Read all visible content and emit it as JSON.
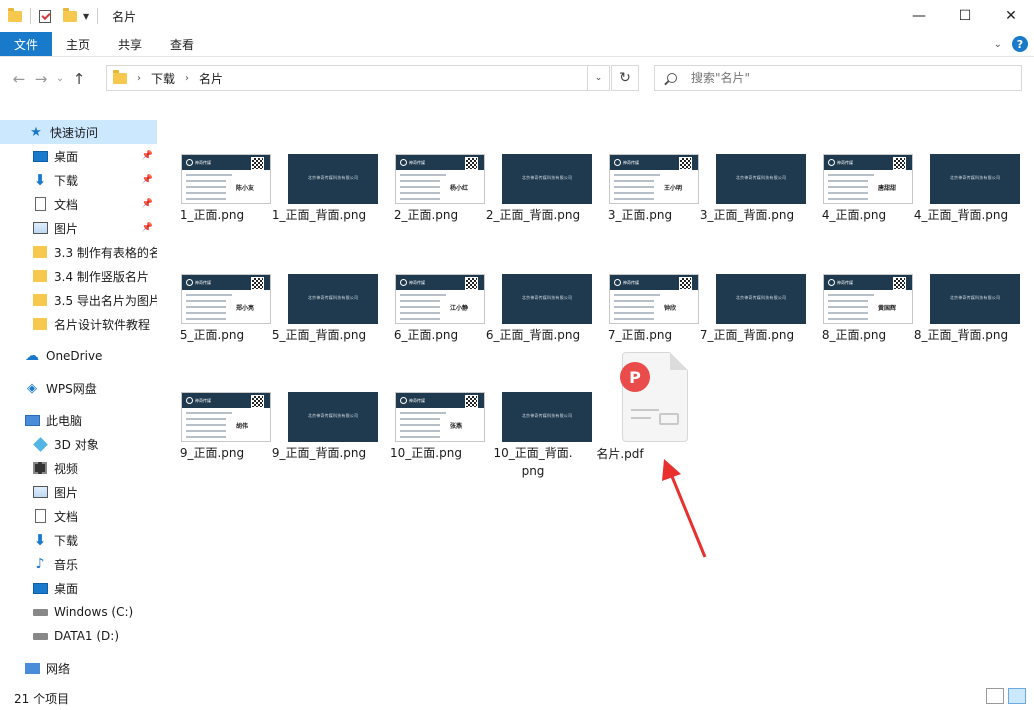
{
  "window": {
    "title": "名片",
    "minimize": "—",
    "maximize": "☐",
    "close": "✕"
  },
  "ribbon": {
    "tabs": [
      "文件",
      "主页",
      "共享",
      "查看"
    ],
    "help": "?"
  },
  "nav": {
    "back": "←",
    "forward": "→",
    "recent": "⌄",
    "up": "↑",
    "breadcrumb": [
      "下载",
      "名片"
    ],
    "refresh": "↻"
  },
  "search": {
    "placeholder": "搜索\"名片\""
  },
  "sidebar": {
    "quick_access": "快速访问",
    "pinned": [
      {
        "label": "桌面",
        "icon": "desktop-icon"
      },
      {
        "label": "下载",
        "icon": "download-arrow-icon"
      },
      {
        "label": "文档",
        "icon": "document-icon"
      },
      {
        "label": "图片",
        "icon": "pictures-icon"
      }
    ],
    "recent_folders": [
      "3.3 制作有表格的名",
      "3.4 制作竖版名片",
      "3.5 导出名片为图片",
      "名片设计软件教程"
    ],
    "onedrive": "OneDrive",
    "wps": "WPS网盘",
    "this_pc": "此电脑",
    "pc_items": [
      {
        "label": "3D 对象",
        "icon": "3d-objects-icon"
      },
      {
        "label": "视频",
        "icon": "video-icon"
      },
      {
        "label": "图片",
        "icon": "pictures-icon"
      },
      {
        "label": "文档",
        "icon": "document-icon"
      },
      {
        "label": "下载",
        "icon": "download-arrow-icon"
      },
      {
        "label": "音乐",
        "icon": "music-icon"
      },
      {
        "label": "桌面",
        "icon": "desktop-icon"
      },
      {
        "label": "Windows (C:)",
        "icon": "windows-drive-icon"
      },
      {
        "label": "DATA1 (D:)",
        "icon": "drive-icon"
      }
    ],
    "network": "网络"
  },
  "files": {
    "rows": [
      [
        {
          "label": "1_正面.png",
          "name": "陈小友"
        },
        {
          "label": "1_正面_背面.png"
        },
        {
          "label": "2_正面.png",
          "name": "杨小红"
        },
        {
          "label": "2_正面_背面.png"
        },
        {
          "label": "3_正面.png",
          "name": "王小明"
        },
        {
          "label": "3_正面_背面.png"
        },
        {
          "label": "4_正面.png",
          "name": "唐甜甜"
        },
        {
          "label": "4_正面_背面.png"
        }
      ],
      [
        {
          "label": "5_正面.png",
          "name": "郑小亮"
        },
        {
          "label": "5_正面_背面.png"
        },
        {
          "label": "6_正面.png",
          "name": "江小静"
        },
        {
          "label": "6_正面_背面.png"
        },
        {
          "label": "7_正面.png",
          "name": "钟欣"
        },
        {
          "label": "7_正面_背面.png"
        },
        {
          "label": "8_正面.png",
          "name": "黄国辉"
        },
        {
          "label": "8_正面_背面.png"
        }
      ],
      [
        {
          "label": "9_正面.png",
          "name": "胡伟"
        },
        {
          "label": "9_正面_背面.png"
        },
        {
          "label": "10_正面.png",
          "name": "张燕"
        },
        {
          "label": "10_正面_背面.\npng"
        }
      ]
    ],
    "card_back_text": "北京神奇传媒科技有限公司",
    "card_front_brand": "神奇传媒",
    "pdf": {
      "label": "名片.pdf",
      "badge": "P"
    }
  },
  "status": {
    "count": "21 个项目"
  },
  "colors": {
    "accent": "#1979ca",
    "selection": "#cce8ff",
    "card_dark": "#1f3a4f",
    "pdf_red": "#ea4b4b",
    "arrow_red": "#e8302f"
  }
}
